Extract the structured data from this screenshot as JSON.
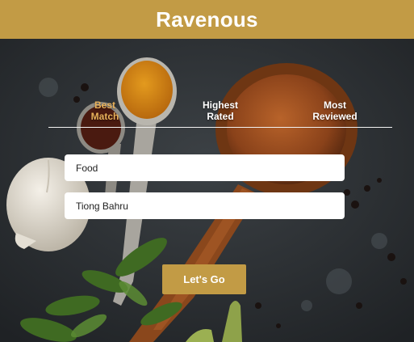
{
  "app": {
    "title": "Ravenous"
  },
  "colors": {
    "brand": "#c29b45",
    "active_tab": "#e8b15a",
    "tab_text": "#ffffff",
    "background_slate": "#2b2e31"
  },
  "sort_tabs": [
    {
      "label_line1": "Best",
      "label_line2": "Match",
      "active": true
    },
    {
      "label_line1": "Highest",
      "label_line2": "Rated",
      "active": false
    },
    {
      "label_line1": "Most",
      "label_line2": "Reviewed",
      "active": false
    }
  ],
  "search": {
    "term_value": "Food",
    "location_value": "Tiong Bahru",
    "submit_label": "Let's Go"
  },
  "background": {
    "image_name": "spices-wooden-spoon-slate"
  }
}
